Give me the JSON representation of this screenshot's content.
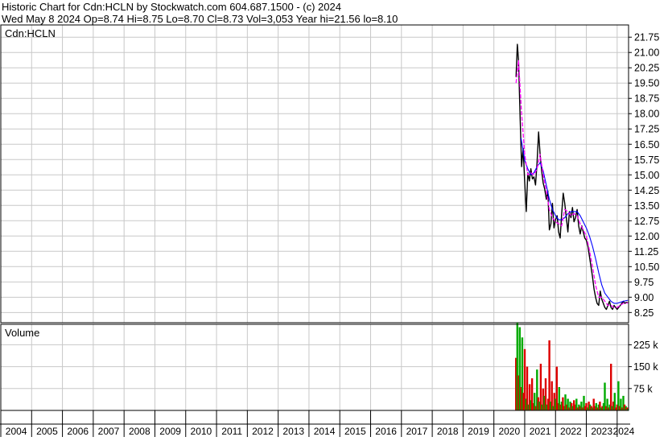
{
  "header": {
    "line1": "Historic Chart for Cdn:HCLN by Stockwatch.com 604.687.1500 - (c) 2024",
    "line2": "Wed May  8 2024   Op=8.74  Hi=8.75   Lo=8.70   Cl=8.73   Vol=3,053   Year hi=21.56   lo=8.10"
  },
  "price_panel": {
    "label": "Cdn:HCLN"
  },
  "volume_panel": {
    "label": "Volume"
  },
  "chart_data": [
    {
      "type": "line",
      "title": "Cdn:HCLN",
      "x_axis": {
        "ticks": [
          "2004",
          "2005",
          "2006",
          "2007",
          "2008",
          "2009",
          "2010",
          "2011",
          "2012",
          "2013",
          "2014",
          "2015",
          "2016",
          "2017",
          "2018",
          "2019",
          "2020",
          "2021",
          "2022",
          "2023",
          "2024"
        ],
        "range": [
          2004.0,
          2024.37
        ]
      },
      "y_axis": {
        "side": "right",
        "ticks": [
          8.25,
          9.0,
          9.75,
          10.5,
          11.25,
          12.0,
          12.75,
          13.5,
          14.25,
          15.0,
          15.75,
          16.5,
          17.25,
          18.0,
          18.75,
          19.5,
          20.25,
          21.0,
          21.75
        ],
        "range": [
          7.75,
          22.35
        ]
      },
      "grid": true,
      "colors": {
        "price": "#000000",
        "ma_short": "#ff00ff",
        "ma_long": "#0000ff"
      },
      "series": [
        {
          "key": "price",
          "x": [
            2020.72,
            2020.76,
            2020.8,
            2020.85,
            2020.9,
            2020.95,
            2021.0,
            2021.05,
            2021.1,
            2021.15,
            2021.2,
            2021.25,
            2021.3,
            2021.35,
            2021.4,
            2021.45,
            2021.5,
            2021.55,
            2021.6,
            2021.65,
            2021.7,
            2021.75,
            2021.8,
            2021.85,
            2021.9,
            2021.95,
            2022.0,
            2022.05,
            2022.1,
            2022.15,
            2022.2,
            2022.25,
            2022.3,
            2022.35,
            2022.4,
            2022.45,
            2022.5,
            2022.55,
            2022.6,
            2022.65,
            2022.7,
            2022.75,
            2022.8,
            2022.85,
            2022.9,
            2022.95,
            2023.0,
            2023.05,
            2023.1,
            2023.15,
            2023.2,
            2023.25,
            2023.3,
            2023.35,
            2023.4,
            2023.45,
            2023.5,
            2023.55,
            2023.6,
            2023.65,
            2023.7,
            2023.75,
            2023.8,
            2023.85,
            2023.9,
            2023.95,
            2024.0,
            2024.05,
            2024.1,
            2024.15,
            2024.2,
            2024.25,
            2024.3,
            2024.35
          ],
          "y": [
            19.8,
            21.4,
            20.6,
            17.9,
            15.4,
            16.3,
            14.6,
            13.2,
            15.1,
            14.7,
            15.3,
            14.8,
            14.9,
            14.5,
            15.6,
            17.1,
            16.0,
            15.2,
            14.6,
            14.3,
            13.8,
            14.2,
            12.3,
            12.6,
            13.6,
            12.4,
            12.8,
            13.0,
            12.2,
            11.9,
            13.1,
            14.1,
            13.6,
            12.9,
            12.2,
            13.2,
            12.9,
            13.4,
            12.7,
            12.9,
            13.3,
            12.5,
            12.1,
            12.5,
            12.2,
            11.9,
            11.8,
            11.5,
            11.0,
            10.5,
            10.0,
            9.4,
            9.0,
            8.7,
            8.6,
            9.3,
            8.9,
            8.7,
            8.5,
            8.4,
            8.6,
            8.8,
            8.5,
            8.4,
            8.6,
            8.5,
            8.4,
            8.5,
            8.6,
            8.7,
            8.8,
            8.7,
            8.75,
            8.73
          ]
        },
        {
          "key": "ma_short",
          "x": [
            2020.72,
            2020.8,
            2020.9,
            2021.0,
            2021.1,
            2021.2,
            2021.3,
            2021.4,
            2021.5,
            2021.6,
            2021.7,
            2021.8,
            2021.9,
            2022.0,
            2022.1,
            2022.2,
            2022.3,
            2022.4,
            2022.5,
            2022.6,
            2022.7,
            2022.8,
            2022.9,
            2023.0,
            2023.1,
            2023.2,
            2023.3,
            2023.4,
            2023.5,
            2023.6,
            2023.7,
            2023.8,
            2023.9,
            2024.0,
            2024.1,
            2024.2,
            2024.35
          ],
          "y": [
            19.5,
            20.6,
            18.0,
            16.0,
            15.0,
            15.1,
            15.0,
            15.3,
            16.0,
            15.0,
            14.2,
            13.3,
            12.9,
            12.7,
            12.6,
            12.5,
            13.3,
            13.2,
            13.0,
            13.1,
            13.0,
            12.6,
            12.3,
            12.0,
            11.3,
            10.5,
            9.6,
            9.0,
            9.0,
            8.8,
            8.6,
            8.6,
            8.5,
            8.5,
            8.6,
            8.7,
            8.72
          ]
        },
        {
          "key": "ma_long",
          "x": [
            2020.88,
            2021.0,
            2021.1,
            2021.2,
            2021.3,
            2021.4,
            2021.5,
            2021.6,
            2021.7,
            2021.8,
            2021.9,
            2022.0,
            2022.1,
            2022.2,
            2022.3,
            2022.4,
            2022.5,
            2022.6,
            2022.7,
            2022.8,
            2022.9,
            2023.0,
            2023.1,
            2023.2,
            2023.3,
            2023.4,
            2023.5,
            2023.6,
            2023.7,
            2023.8,
            2023.9,
            2024.0,
            2024.1,
            2024.2,
            2024.35
          ],
          "y": [
            16.8,
            15.7,
            15.3,
            15.0,
            15.1,
            15.4,
            15.6,
            15.2,
            14.5,
            13.8,
            13.3,
            13.0,
            12.8,
            12.8,
            12.9,
            13.1,
            13.2,
            13.2,
            13.2,
            13.0,
            12.7,
            12.4,
            12.0,
            11.5,
            10.9,
            10.2,
            9.6,
            9.2,
            9.0,
            8.8,
            8.7,
            8.7,
            8.75,
            8.8,
            8.85
          ]
        }
      ]
    },
    {
      "type": "bar",
      "title": "Volume",
      "y_axis": {
        "side": "right",
        "ticks": [
          75000,
          150000,
          225000
        ],
        "tick_labels": [
          "75 k",
          "150 k",
          "225 k"
        ],
        "range": [
          0,
          295000
        ]
      },
      "grid": true,
      "colors": {
        "up": "#00aa00",
        "down": "#dd0000"
      },
      "x": [
        2020.72,
        2020.76,
        2020.8,
        2020.84,
        2020.88,
        2020.92,
        2020.96,
        2021.0,
        2021.04,
        2021.08,
        2021.12,
        2021.16,
        2021.2,
        2021.24,
        2021.28,
        2021.32,
        2021.36,
        2021.4,
        2021.44,
        2021.48,
        2021.52,
        2021.56,
        2021.6,
        2021.64,
        2021.68,
        2021.72,
        2021.76,
        2021.8,
        2021.84,
        2021.88,
        2021.92,
        2021.96,
        2022.0,
        2022.04,
        2022.08,
        2022.12,
        2022.16,
        2022.2,
        2022.24,
        2022.28,
        2022.32,
        2022.36,
        2022.4,
        2022.44,
        2022.48,
        2022.52,
        2022.56,
        2022.6,
        2022.64,
        2022.68,
        2022.72,
        2022.76,
        2022.8,
        2022.84,
        2022.88,
        2022.92,
        2022.96,
        2023.0,
        2023.04,
        2023.08,
        2023.12,
        2023.16,
        2023.2,
        2023.24,
        2023.28,
        2023.32,
        2023.36,
        2023.4,
        2023.44,
        2023.48,
        2023.52,
        2023.56,
        2023.6,
        2023.64,
        2023.68,
        2023.72,
        2023.76,
        2023.8,
        2023.84,
        2023.88,
        2023.92,
        2023.96,
        2024.0,
        2024.04,
        2024.08,
        2024.12,
        2024.16,
        2024.2,
        2024.24,
        2024.28,
        2024.32,
        2024.35
      ],
      "values": [
        180000,
        300000,
        120000,
        285000,
        80000,
        250000,
        60000,
        210000,
        40000,
        150000,
        20000,
        90000,
        35000,
        110000,
        25000,
        60000,
        15000,
        140000,
        45000,
        30000,
        160000,
        20000,
        75000,
        50000,
        110000,
        20000,
        40000,
        240000,
        30000,
        100000,
        15000,
        60000,
        40000,
        150000,
        25000,
        80000,
        20000,
        30000,
        45000,
        15000,
        55000,
        20000,
        40000,
        10000,
        30000,
        25000,
        15000,
        35000,
        20000,
        40000,
        10000,
        20000,
        15000,
        30000,
        10000,
        50000,
        15000,
        25000,
        10000,
        30000,
        20000,
        15000,
        10000,
        40000,
        15000,
        25000,
        10000,
        20000,
        30000,
        10000,
        15000,
        25000,
        95000,
        15000,
        40000,
        10000,
        20000,
        160000,
        15000,
        30000,
        60000,
        10000,
        20000,
        100000,
        15000,
        40000,
        10000,
        50000,
        20000,
        15000,
        10000,
        5000
      ],
      "up": [
        0,
        1,
        0,
        1,
        0,
        1,
        0,
        0,
        1,
        0,
        1,
        0,
        1,
        0,
        0,
        1,
        0,
        1,
        0,
        1,
        0,
        1,
        0,
        1,
        0,
        1,
        0,
        0,
        1,
        0,
        1,
        0,
        1,
        0,
        0,
        1,
        0,
        1,
        0,
        0,
        1,
        0,
        1,
        0,
        1,
        0,
        1,
        0,
        0,
        1,
        0,
        1,
        0,
        1,
        0,
        1,
        0,
        0,
        1,
        0,
        1,
        0,
        1,
        0,
        0,
        1,
        0,
        1,
        0,
        1,
        0,
        1,
        1,
        0,
        1,
        0,
        1,
        0,
        1,
        0,
        1,
        0,
        0,
        1,
        0,
        1,
        0,
        1,
        0,
        1,
        0,
        1
      ]
    }
  ]
}
